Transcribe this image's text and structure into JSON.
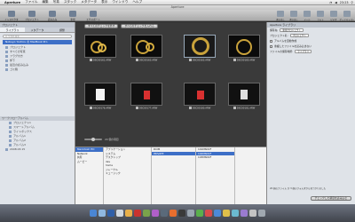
{
  "menubar": {
    "app": "Aperture",
    "items": [
      "ファイル",
      "編集",
      "写真",
      "スタック",
      "メタデータ",
      "表示",
      "ウインドウ",
      "ヘルプ"
    ],
    "clock": "23:23"
  },
  "window": {
    "title": "Aperture"
  },
  "toolbar": {
    "left": [
      "インスペクタ",
      "プロジェクト",
      "読み込み",
      "新規",
      "エクスポート"
    ],
    "right": [
      "書き出し",
      "書き出し",
      "メール",
      "フォト",
      "ビデオ",
      "ポッドキャスト"
    ]
  },
  "sidebar": {
    "header": "プロジェクト",
    "tabs": [
      "ライブラリ",
      "メタデータ",
      "調整"
    ],
    "search_placeholder": "Q 全部を検索",
    "device": "Nobuyo Yochiru の MacBook Pro",
    "library": [
      "プロジェクト",
      "すべての写真",
      "フラグ付き",
      "却下",
      "最近の読み込み",
      "ゴミ箱"
    ],
    "section": "ワークフローアルバム",
    "subs": [
      "プロジェクト1",
      "スマートアルバム",
      "ライトボックス",
      "アルバム1",
      "アルバム2",
      "アルバム3"
    ],
    "date": "2008.03.15"
  },
  "browser": {
    "filter_buttons": [
      "すべてのチェックを外す",
      "すべてのチェックを入れる"
    ],
    "items": [
      "DSC00161.ARW",
      "DSC00163.ARW",
      "DSC00163.ARW",
      "DSC00165.ARW",
      "DSC00176.ARW",
      "DSC00177.ARW",
      "DSC00180.ARW",
      "DSC00181.ARW"
    ],
    "status": "20 個の項目"
  },
  "inspector": {
    "header": "Aperture ライブラリ",
    "rows": [
      {
        "label": "保存先:",
        "value": "新規プロジェクト"
      },
      {
        "label": "プロジェクト名:",
        "value": "プロジェクト"
      }
    ],
    "checks": [
      "アルバムを自動作成",
      "重複したファイルを読み込まない"
    ],
    "file_label": "ファイルの保存場所:",
    "file_value": "ライブラリ",
    "foot": "20 個のファイル が 3 個のフォルダから見つかりました",
    "import_button": "チェックした項目を読み込む"
  },
  "columns": [
    [
      "Macintosh HD",
      "Network",
      "共有",
      "ムービー"
    ],
    [
      "アプリケーション",
      "システム",
      "デスクトップ",
      "dev",
      "home",
      "ジャーナル",
      "ミュージック"
    ],
    [
      "DCIM",
      "PRIVATE"
    ],
    [
      "101MSDCF",
      "102MSDCF",
      "103MSDCF"
    ],
    []
  ],
  "colors": {
    "selection": "#3d6fc7",
    "browser_bg": "#3a3a3a"
  }
}
